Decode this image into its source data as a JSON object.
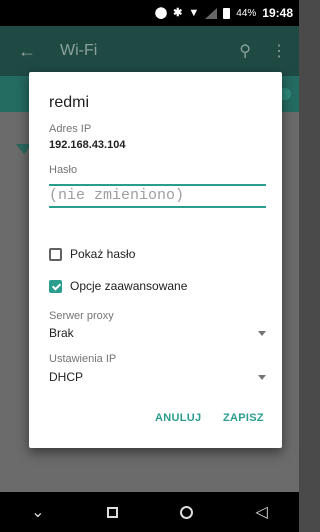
{
  "status_bar": {
    "icons": [
      "location-icon",
      "bluetooth-icon",
      "wifi-icon",
      "signal-icon",
      "battery-icon"
    ],
    "battery_percent": "44%",
    "time": "19:48"
  },
  "app_bar": {
    "back_icon": "←",
    "title": "Wi-Fi",
    "search_icon": "⚲",
    "more_icon": "⋮"
  },
  "dialog": {
    "title": "redmi",
    "ip_label": "Adres IP",
    "ip_value": "192.168.43.104",
    "password_label": "Hasło",
    "password_placeholder": "(nie zmieniono)",
    "show_password": {
      "label": "Pokaż hasło",
      "checked": false
    },
    "advanced_options": {
      "label": "Opcje zaawansowane",
      "checked": true
    },
    "proxy": {
      "label": "Serwer proxy",
      "value": "Brak"
    },
    "ip_settings": {
      "label": "Ustawienia IP",
      "value": "DHCP"
    },
    "cancel_label": "ANULUJ",
    "save_label": "ZAPISZ"
  },
  "nav_bar": {
    "back_icon": "◁",
    "recent_icon": "square",
    "home_icon": "circle",
    "hide_keyboard_icon": "⌄"
  },
  "colors": {
    "accent": "#2a9d8f",
    "app_bar": "#1f4a44"
  }
}
